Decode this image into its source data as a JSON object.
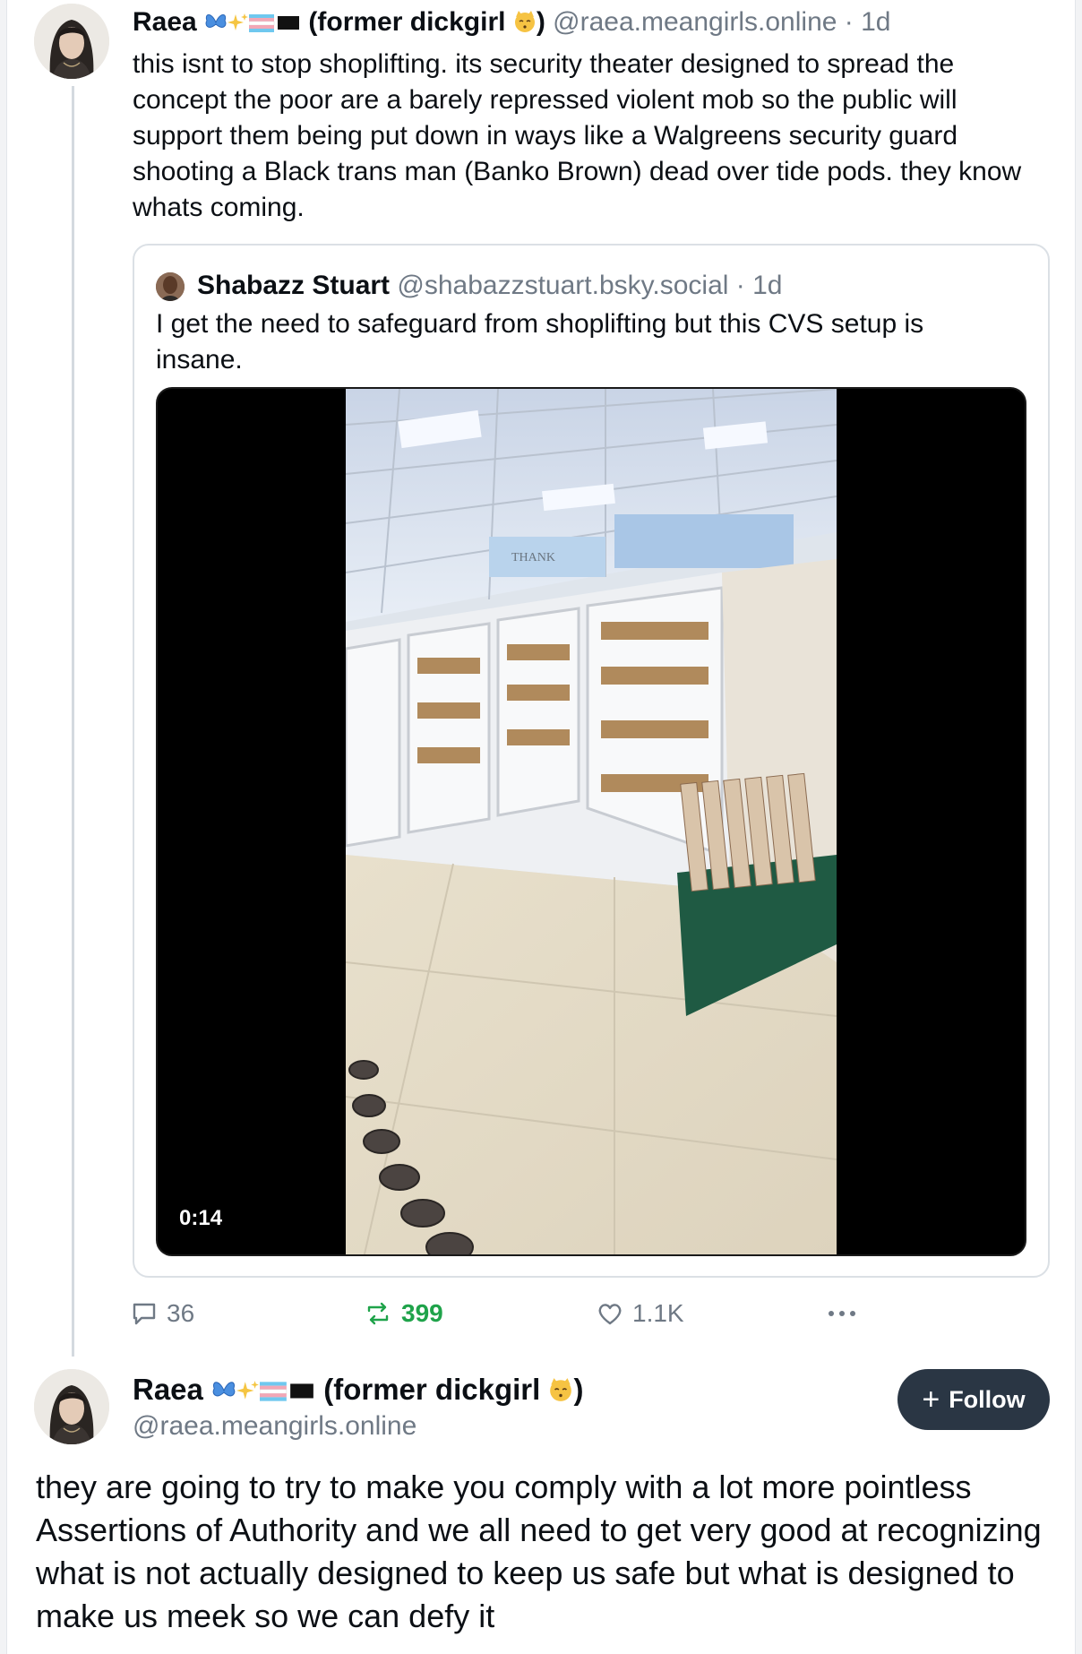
{
  "post1": {
    "author": {
      "name": "Raea",
      "name_suffix": "(former dickgirl",
      "name_close": ")",
      "emoji": [
        "butterfly-emoji",
        "sparkles-emoji",
        "trans-flag-emoji",
        "black-flag-emoji",
        "kissing-cat-emoji"
      ],
      "handle": "@raea.meangirls.online",
      "time": "· 1d"
    },
    "text": "this isnt to stop shoplifting. its security theater designed to spread the concept the poor are a barely repressed violent mob so the public will support them being put down in ways like a Walgreens security guard shooting a Black trans man (Banko Brown) dead over tide pods. they know whats coming.",
    "quote": {
      "author_name": "Shabazz Stuart",
      "author_handle": "@shabazzstuart.bsky.social",
      "time": "· 1d",
      "text": "I get the need to safeguard from shoplifting but this CVS setup is insane.",
      "video": {
        "duration": "0:14",
        "sign_text": "THANK"
      }
    },
    "actions": {
      "replies": "36",
      "reposts": "399",
      "likes": "1.1K"
    }
  },
  "post2": {
    "author": {
      "name": "Raea",
      "name_suffix": "(former dickgirl",
      "name_close": ")",
      "handle": "@raea.meangirls.online"
    },
    "follow_label": "Follow",
    "text": "they are going to try to make you comply with a lot more pointless Assertions of Authority and we all need to get very good at recognizing what is not actually designed to keep us safe but what is designed to make us meek so we can defy it"
  },
  "colors": {
    "repost_active": "#1fa34a",
    "muted": "#6f7985",
    "follow_bg": "#2a3644"
  }
}
